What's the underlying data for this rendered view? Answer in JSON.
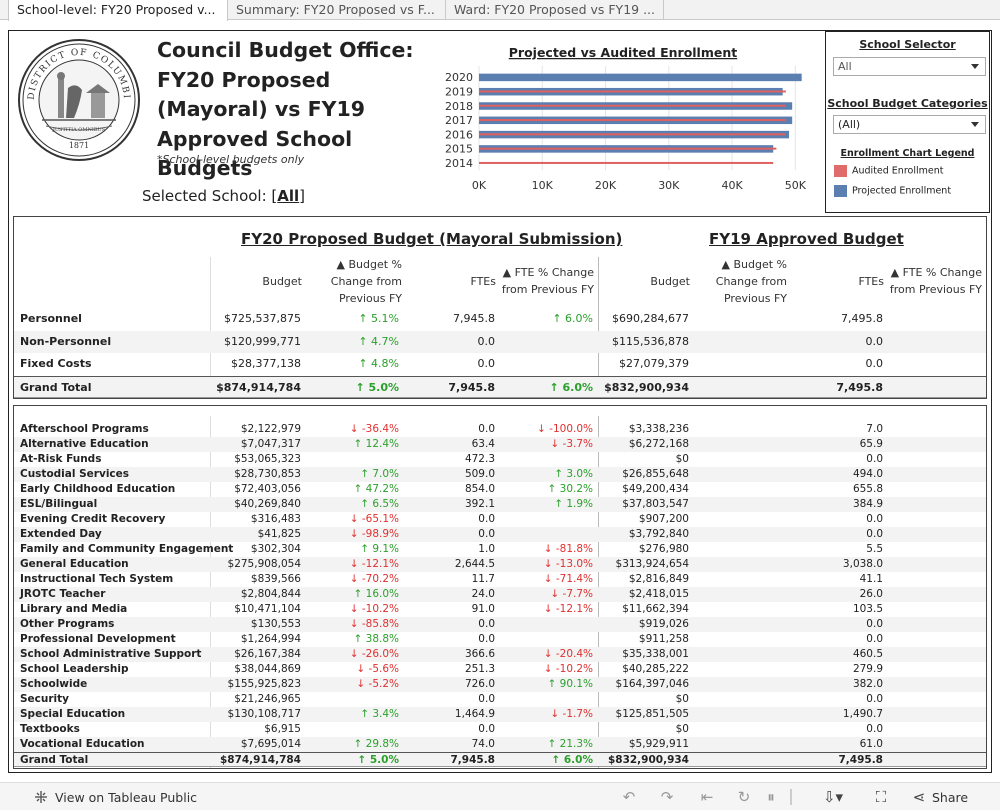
{
  "tabs": [
    {
      "label": "School-level: FY20 Proposed v..."
    },
    {
      "label": "Summary: FY20 Proposed vs F..."
    },
    {
      "label": "Ward: FY20 Proposed vs FY19 ..."
    }
  ],
  "seal": {
    "text": "DISTRICT OF COLUMBIA",
    "motto": "JUSTITIA OMNIBUS",
    "year": "1871"
  },
  "header": {
    "title": "Council Budget Office: FY20 Proposed (Mayoral) vs FY19 Approved School Budgets",
    "subtitle": "*School-level budgets only",
    "selected_school_prefix": "Selected School: [",
    "selected_school_value": "All",
    "selected_school_suffix": "]"
  },
  "chart_data": {
    "type": "bar",
    "orientation": "horizontal",
    "title": "Projected vs Audited Enrollment",
    "categories": [
      "2020",
      "2019",
      "2018",
      "2017",
      "2016",
      "2015",
      "2014"
    ],
    "series": [
      {
        "name": "Projected Enrollment",
        "color": "#5b7fb0",
        "values": [
          51000,
          48000,
          49500,
          49500,
          49000,
          46500,
          null
        ]
      },
      {
        "name": "Audited Enrollment",
        "color": "#e06060",
        "values": [
          null,
          48500,
          48500,
          48500,
          48500,
          47000,
          46500
        ]
      }
    ],
    "xlim": [
      0,
      52000
    ],
    "ticks": [
      {
        "v": 0,
        "label": "0K"
      },
      {
        "v": 10000,
        "label": "10K"
      },
      {
        "v": 20000,
        "label": "20K"
      },
      {
        "v": 30000,
        "label": "30K"
      },
      {
        "v": 40000,
        "label": "40K"
      },
      {
        "v": 50000,
        "label": "50K"
      }
    ],
    "grid": true
  },
  "controls": {
    "school_selector_title": "School Selector",
    "school_selector_value": "All",
    "categories_title": "School Budget Categories",
    "categories_value": "(All)",
    "legend_title": "Enrollment Chart Legend",
    "legend": [
      {
        "label": "Audited Enrollment",
        "color": "#e06b6b"
      },
      {
        "label": "Projected Enrollment",
        "color": "#5b7fb0"
      }
    ]
  },
  "summary": {
    "fy20_title": "FY20 Proposed Budget (Mayoral Submission)",
    "fy19_title": "FY19 Approved Budget",
    "fy20_cols": {
      "budget": "Budget",
      "budget_change": [
        "▲ Budget %",
        "Change from",
        "Previous FY"
      ],
      "ftes": "FTEs",
      "fte_change": [
        "▲ FTE % Change",
        "from Previous FY"
      ]
    },
    "fy19_cols": {
      "budget": "Budget",
      "budget_change": [
        "▲ Budget %",
        "Change from",
        "Previous FY"
      ],
      "ftes": "FTEs",
      "fte_change": [
        "▲ FTE % Change",
        "from Previous FY"
      ]
    },
    "rows": [
      {
        "label": "Personnel",
        "budget": "$725,537,875",
        "budget_change": "5.1%",
        "budget_dir": "up",
        "ftes": "7,945.8",
        "fte_change": "6.0%",
        "fte_dir": "up",
        "fy19_budget": "$690,284,677",
        "fy19_ftes": "7,495.8"
      },
      {
        "label": "Non-Personnel",
        "budget": "$120,999,771",
        "budget_change": "4.7%",
        "budget_dir": "up",
        "ftes": "0.0",
        "fte_change": "",
        "fte_dir": "",
        "fy19_budget": "$115,536,878",
        "fy19_ftes": "0.0"
      },
      {
        "label": "Fixed Costs",
        "budget": "$28,377,138",
        "budget_change": "4.8%",
        "budget_dir": "up",
        "ftes": "0.0",
        "fte_change": "",
        "fte_dir": "",
        "fy19_budget": "$27,079,379",
        "fy19_ftes": "0.0"
      },
      {
        "label": "Grand Total",
        "budget": "$874,914,784",
        "budget_change": "5.0%",
        "budget_dir": "up",
        "ftes": "7,945.8",
        "fte_change": "6.0%",
        "fte_dir": "up",
        "fy19_budget": "$832,900,934",
        "fy19_ftes": "7,495.8"
      }
    ]
  },
  "detail": {
    "rows": [
      {
        "label": "Afterschool Programs",
        "budget": "$2,122,979",
        "budget_change": "-36.4%",
        "budget_dir": "down",
        "ftes": "0.0",
        "fte_change": "-100.0%",
        "fte_dir": "down",
        "fy19_budget": "$3,338,236",
        "fy19_ftes": "7.0"
      },
      {
        "label": "Alternative Education",
        "budget": "$7,047,317",
        "budget_change": "12.4%",
        "budget_dir": "up",
        "ftes": "63.4",
        "fte_change": "-3.7%",
        "fte_dir": "down",
        "fy19_budget": "$6,272,168",
        "fy19_ftes": "65.9"
      },
      {
        "label": "At-Risk Funds",
        "budget": "$53,065,323",
        "budget_change": "",
        "budget_dir": "",
        "ftes": "472.3",
        "fte_change": "",
        "fte_dir": "",
        "fy19_budget": "$0",
        "fy19_ftes": "0.0"
      },
      {
        "label": "Custodial Services",
        "budget": "$28,730,853",
        "budget_change": "7.0%",
        "budget_dir": "up",
        "ftes": "509.0",
        "fte_change": "3.0%",
        "fte_dir": "up",
        "fy19_budget": "$26,855,648",
        "fy19_ftes": "494.0"
      },
      {
        "label": "Early Childhood Education",
        "budget": "$72,403,056",
        "budget_change": "47.2%",
        "budget_dir": "up",
        "ftes": "854.0",
        "fte_change": "30.2%",
        "fte_dir": "up",
        "fy19_budget": "$49,200,434",
        "fy19_ftes": "655.8"
      },
      {
        "label": "ESL/Bilingual",
        "budget": "$40,269,840",
        "budget_change": "6.5%",
        "budget_dir": "up",
        "ftes": "392.1",
        "fte_change": "1.9%",
        "fte_dir": "up",
        "fy19_budget": "$37,803,547",
        "fy19_ftes": "384.9"
      },
      {
        "label": "Evening Credit Recovery",
        "budget": "$316,483",
        "budget_change": "-65.1%",
        "budget_dir": "down",
        "ftes": "0.0",
        "fte_change": "",
        "fte_dir": "",
        "fy19_budget": "$907,200",
        "fy19_ftes": "0.0"
      },
      {
        "label": "Extended Day",
        "budget": "$41,825",
        "budget_change": "-98.9%",
        "budget_dir": "down",
        "ftes": "0.0",
        "fte_change": "",
        "fte_dir": "",
        "fy19_budget": "$3,792,840",
        "fy19_ftes": "0.0"
      },
      {
        "label": "Family and Community Engagement",
        "budget": "$302,304",
        "budget_change": "9.1%",
        "budget_dir": "up",
        "ftes": "1.0",
        "fte_change": "-81.8%",
        "fte_dir": "down",
        "fy19_budget": "$276,980",
        "fy19_ftes": "5.5"
      },
      {
        "label": "General Education",
        "budget": "$275,908,054",
        "budget_change": "-12.1%",
        "budget_dir": "down",
        "ftes": "2,644.5",
        "fte_change": "-13.0%",
        "fte_dir": "down",
        "fy19_budget": "$313,924,654",
        "fy19_ftes": "3,038.0"
      },
      {
        "label": "Instructional Tech System",
        "budget": "$839,566",
        "budget_change": "-70.2%",
        "budget_dir": "down",
        "ftes": "11.7",
        "fte_change": "-71.4%",
        "fte_dir": "down",
        "fy19_budget": "$2,816,849",
        "fy19_ftes": "41.1"
      },
      {
        "label": "JROTC Teacher",
        "budget": "$2,804,844",
        "budget_change": "16.0%",
        "budget_dir": "up",
        "ftes": "24.0",
        "fte_change": "-7.7%",
        "fte_dir": "down",
        "fy19_budget": "$2,418,015",
        "fy19_ftes": "26.0"
      },
      {
        "label": "Library and Media",
        "budget": "$10,471,104",
        "budget_change": "-10.2%",
        "budget_dir": "down",
        "ftes": "91.0",
        "fte_change": "-12.1%",
        "fte_dir": "down",
        "fy19_budget": "$11,662,394",
        "fy19_ftes": "103.5"
      },
      {
        "label": "Other Programs",
        "budget": "$130,553",
        "budget_change": "-85.8%",
        "budget_dir": "down",
        "ftes": "0.0",
        "fte_change": "",
        "fte_dir": "",
        "fy19_budget": "$919,026",
        "fy19_ftes": "0.0"
      },
      {
        "label": "Professional Development",
        "budget": "$1,264,994",
        "budget_change": "38.8%",
        "budget_dir": "up",
        "ftes": "0.0",
        "fte_change": "",
        "fte_dir": "",
        "fy19_budget": "$911,258",
        "fy19_ftes": "0.0"
      },
      {
        "label": "School Administrative Support",
        "budget": "$26,167,384",
        "budget_change": "-26.0%",
        "budget_dir": "down",
        "ftes": "366.6",
        "fte_change": "-20.4%",
        "fte_dir": "down",
        "fy19_budget": "$35,338,001",
        "fy19_ftes": "460.5"
      },
      {
        "label": "School Leadership",
        "budget": "$38,044,869",
        "budget_change": "-5.6%",
        "budget_dir": "down",
        "ftes": "251.3",
        "fte_change": "-10.2%",
        "fte_dir": "down",
        "fy19_budget": "$40,285,222",
        "fy19_ftes": "279.9"
      },
      {
        "label": "Schoolwide",
        "budget": "$155,925,823",
        "budget_change": "-5.2%",
        "budget_dir": "down",
        "ftes": "726.0",
        "fte_change": "90.1%",
        "fte_dir": "up",
        "fy19_budget": "$164,397,046",
        "fy19_ftes": "382.0"
      },
      {
        "label": "Security",
        "budget": "$21,246,965",
        "budget_change": "",
        "budget_dir": "",
        "ftes": "0.0",
        "fte_change": "",
        "fte_dir": "",
        "fy19_budget": "$0",
        "fy19_ftes": "0.0"
      },
      {
        "label": "Special Education",
        "budget": "$130,108,717",
        "budget_change": "3.4%",
        "budget_dir": "up",
        "ftes": "1,464.9",
        "fte_change": "-1.7%",
        "fte_dir": "down",
        "fy19_budget": "$125,851,505",
        "fy19_ftes": "1,490.7"
      },
      {
        "label": "Textbooks",
        "budget": "$6,915",
        "budget_change": "",
        "budget_dir": "",
        "ftes": "0.0",
        "fte_change": "",
        "fte_dir": "",
        "fy19_budget": "$0",
        "fy19_ftes": "0.0"
      },
      {
        "label": "Vocational Education",
        "budget": "$7,695,014",
        "budget_change": "29.8%",
        "budget_dir": "up",
        "ftes": "74.0",
        "fte_change": "21.3%",
        "fte_dir": "up",
        "fy19_budget": "$5,929,911",
        "fy19_ftes": "61.0"
      },
      {
        "label": "Grand Total",
        "budget": "$874,914,784",
        "budget_change": "5.0%",
        "budget_dir": "up",
        "ftes": "7,945.8",
        "fte_change": "6.0%",
        "fte_dir": "up",
        "fy19_budget": "$832,900,934",
        "fy19_ftes": "7,495.8"
      }
    ]
  },
  "footer": {
    "view_label": "View on Tableau Public",
    "share_label": "Share"
  }
}
